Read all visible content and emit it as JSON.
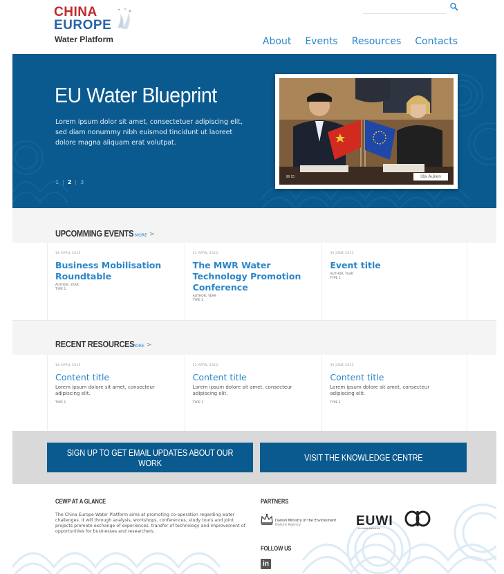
{
  "header": {
    "logo": {
      "line1": "CHINA",
      "line2": "EUROPE",
      "line3": "Water Platform"
    },
    "search": {
      "placeholder": ""
    },
    "nav": [
      "About",
      "Events",
      "Resources",
      "Contacts"
    ]
  },
  "hero": {
    "title": "EU Water Blueprint",
    "text": "Lorem ipsum dolor sit amet, consectetuer adipiscing elit, sed diam nonummy nibh euismod tincidunt ut laoreet dolore magna aliquam erat volutpat.",
    "pager": [
      "1",
      "2",
      "3"
    ],
    "active_page": "2",
    "photo_caption": "Ida Auken",
    "photo_controls": "⊞ ⊡"
  },
  "events": {
    "title": "UPCOMMING EVENTS",
    "more": "MORE",
    "items": [
      {
        "date": "18 APRIL 2013",
        "title": "Business Mobilisation Roundtable",
        "author": "AUTHOR, YEAR",
        "type": "TYPE 1"
      },
      {
        "date": "22 APRIL 2013",
        "title": "The MWR Water Technology Promotion Conference",
        "author": "AUTHOR, YEAR",
        "type": "TYPE 1"
      },
      {
        "date": "30 JUNE 2013",
        "title": "Event title",
        "author": "AUTHOR, YEAR",
        "type": "TYPE 1"
      }
    ]
  },
  "resources": {
    "title": "RECENT RESOURCES",
    "more": "MORE",
    "items": [
      {
        "date": "18 APRIL 2013",
        "title": "Content title",
        "desc": "Lorem ipsum dolore sit amet, consecteur adipiscing elit.",
        "type": "TYPE 1"
      },
      {
        "date": "22 APRIL 2013",
        "title": "Content title",
        "desc": "Lorem ipsum dolore sit amet, consecteur adipiscing elit.",
        "type": "TYPE 1"
      },
      {
        "date": "30 JUNE 2013",
        "title": "Content title",
        "desc": "Lorem ipsum dolore sit amet, consecteur adipiscing elit.",
        "type": "TYPE 1"
      }
    ]
  },
  "cta": {
    "signup": "SIGN UP TO GET EMAIL UPDATES ABOUT OUR WORK",
    "knowledge": "VISIT THE KNOWLEDGE CENTRE"
  },
  "footer": {
    "about_title": "CEWP AT A GLANCE",
    "about_text": "The China Europe Water Platform aims at promoting co-operation regarding water challenges. It will through analysis, workshops, conferences, study tours and joint projects promote exchange of experiences, transfer of technology and improvement of opportunities for businesses and researchers.",
    "partners_title": "PARTNERS",
    "partner_dk": "Danish Ministry of the Environment",
    "partner_dk_sub": "Nature Agency",
    "partner_euwi": "EUWI",
    "partner_euwi_sub": "EU WATER INITIATIVE",
    "follow_title": "FOLLOW US",
    "linkedin": "in"
  },
  "colors": {
    "primary_blue": "#0a5a8f",
    "link_blue": "#2a86c8",
    "logo_red": "#c0292a",
    "band_gray": "#f4f4f4",
    "cta_band": "#d9d9d9"
  }
}
